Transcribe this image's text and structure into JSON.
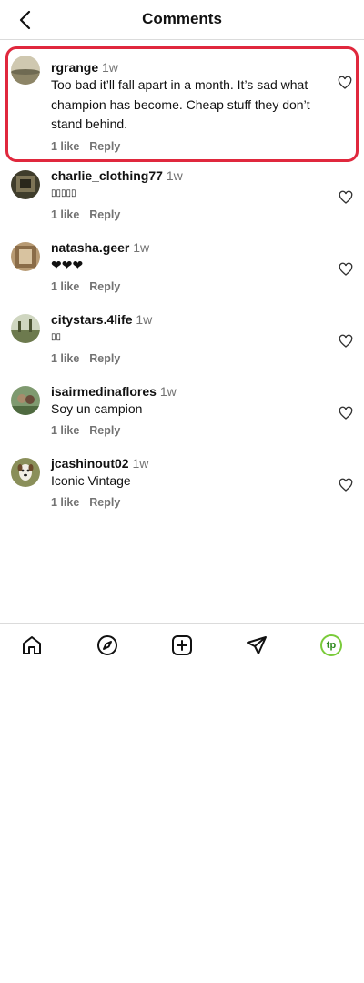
{
  "header": {
    "title": "Comments"
  },
  "comments": [
    {
      "username": "rgrange",
      "time": "1w",
      "text": "Too bad it’ll fall apart in a month. It’s sad what champion has become. Cheap stuff they don’t stand behind.",
      "likes": "1 like",
      "reply": "Reply",
      "avatar_color": "#c9c2a8"
    },
    {
      "username": "charlie_clothing77",
      "time": "1w",
      "text": "▯▯▯▯▯",
      "likes": "1 like",
      "reply": "Reply",
      "avatar_color": "#4d4a36"
    },
    {
      "username": "natasha.geer",
      "time": "1w",
      "text": "❤❤❤",
      "likes": "1 like",
      "reply": "Reply",
      "avatar_color": "#a88c66"
    },
    {
      "username": "citystars.4life",
      "time": "1w",
      "text": "▯▯",
      "likes": "1 like",
      "reply": "Reply",
      "avatar_color": "#9aa37e"
    },
    {
      "username": "isairmedinaflores",
      "time": "1w",
      "text": "Soy un campion",
      "likes": "1 like",
      "reply": "Reply",
      "avatar_color": "#6f8a5c"
    },
    {
      "username": "jcashinout02",
      "time": "1w",
      "text": "Iconic Vintage",
      "likes": "1 like",
      "reply": "Reply",
      "avatar_color": "#8a8f5a"
    }
  ],
  "nav": {
    "items": [
      "home-icon",
      "explore-compass-icon",
      "new-post-icon",
      "direct-send-icon",
      "profile-avatar"
    ],
    "profile_initials": "tp",
    "profile_ring_color": "#7acb3a"
  },
  "colors": {
    "highlight_border": "#e0283d",
    "secondary_text": "#737373"
  }
}
